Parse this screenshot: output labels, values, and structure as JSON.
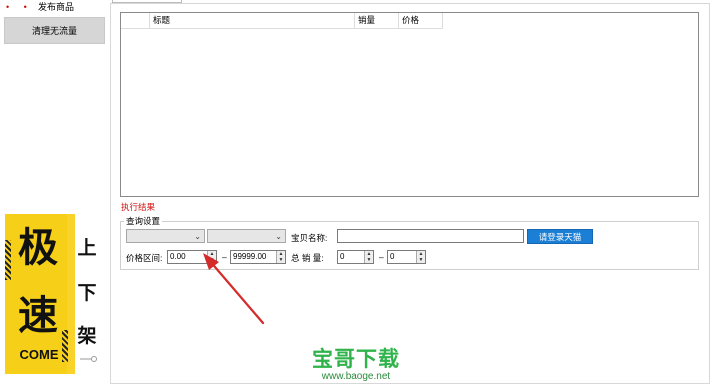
{
  "sidebar": {
    "dots": "• •",
    "items": [
      {
        "label": "发布商品"
      },
      {
        "label": "清理无流量"
      }
    ]
  },
  "banner": {
    "big_chars": [
      "极",
      "速"
    ],
    "small_chars": [
      "上",
      "下",
      "架"
    ],
    "come": "COME"
  },
  "main": {
    "table": {
      "columns": [
        "标题",
        "销量",
        "价格"
      ]
    },
    "exec_result_label": "执行结果",
    "query": {
      "group_title": "查询设置",
      "combo1_value": "",
      "combo2_value": "",
      "item_name_label": "宝贝名称:",
      "item_name_value": "",
      "login_button": "请登录天猫",
      "price_range_label": "价格区间:",
      "price_min": "0.00",
      "dash1": "–",
      "price_max": "99999.00",
      "sales_label": "总 销 量:",
      "sales_min": "0",
      "dash2": "–",
      "sales_max": "0"
    }
  },
  "watermark": {
    "title": "宝哥下载",
    "url": "www.baoge.net"
  },
  "colors": {
    "accent_blue": "#1c7fd6",
    "error_red": "#d01010",
    "banner_yellow": "#f9d32a",
    "watermark_green": "#2fb34a"
  }
}
